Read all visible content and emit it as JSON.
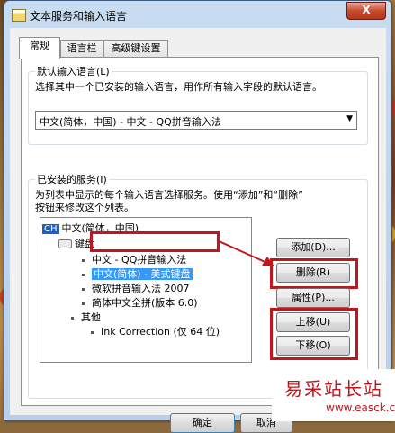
{
  "window": {
    "title": "文本服务和输入语言",
    "close_symbol": "X"
  },
  "tabs": [
    {
      "label": "常规"
    },
    {
      "label": "语言栏"
    },
    {
      "label": "高级键设置"
    }
  ],
  "default_lang": {
    "group_label": "默认输入语言(L)",
    "description": "选择其中一个已安装的输入语言，用作所有输入字段的默认语言。",
    "selected": "中文(简体，中国) - 中文 - QQ拼音输入法"
  },
  "installed": {
    "group_label": "已安装的服务(I)",
    "description_line1": "为列表中显示的每个输入语言选择服务。使用“添加”和“删除”",
    "description_line2": "按钮来修改这个列表。",
    "tree": {
      "language_badge": "CH",
      "language": "中文(简体，中国)",
      "keyboard_label": "键盘",
      "keyboards": [
        "中文 - QQ拼音输入法",
        "中文(简体) - 美式键盘",
        "微软拼音输入法 2007",
        "简体中文全拼(版本 6.0)"
      ],
      "other_label": "其他",
      "others": [
        "Ink Correction (仅 64 位)"
      ]
    }
  },
  "buttons": {
    "add": "添加(D)...",
    "remove": "删除(R)",
    "properties": "属性(P)...",
    "move_up": "上移(U)",
    "move_down": "下移(O)"
  },
  "footer": {
    "ok": "确定",
    "cancel": "取消"
  },
  "watermark": {
    "text": "易采站长站",
    "url": "www.easck.com"
  },
  "colors": {
    "highlight": "#c0171c",
    "selection": "#3399ff"
  }
}
